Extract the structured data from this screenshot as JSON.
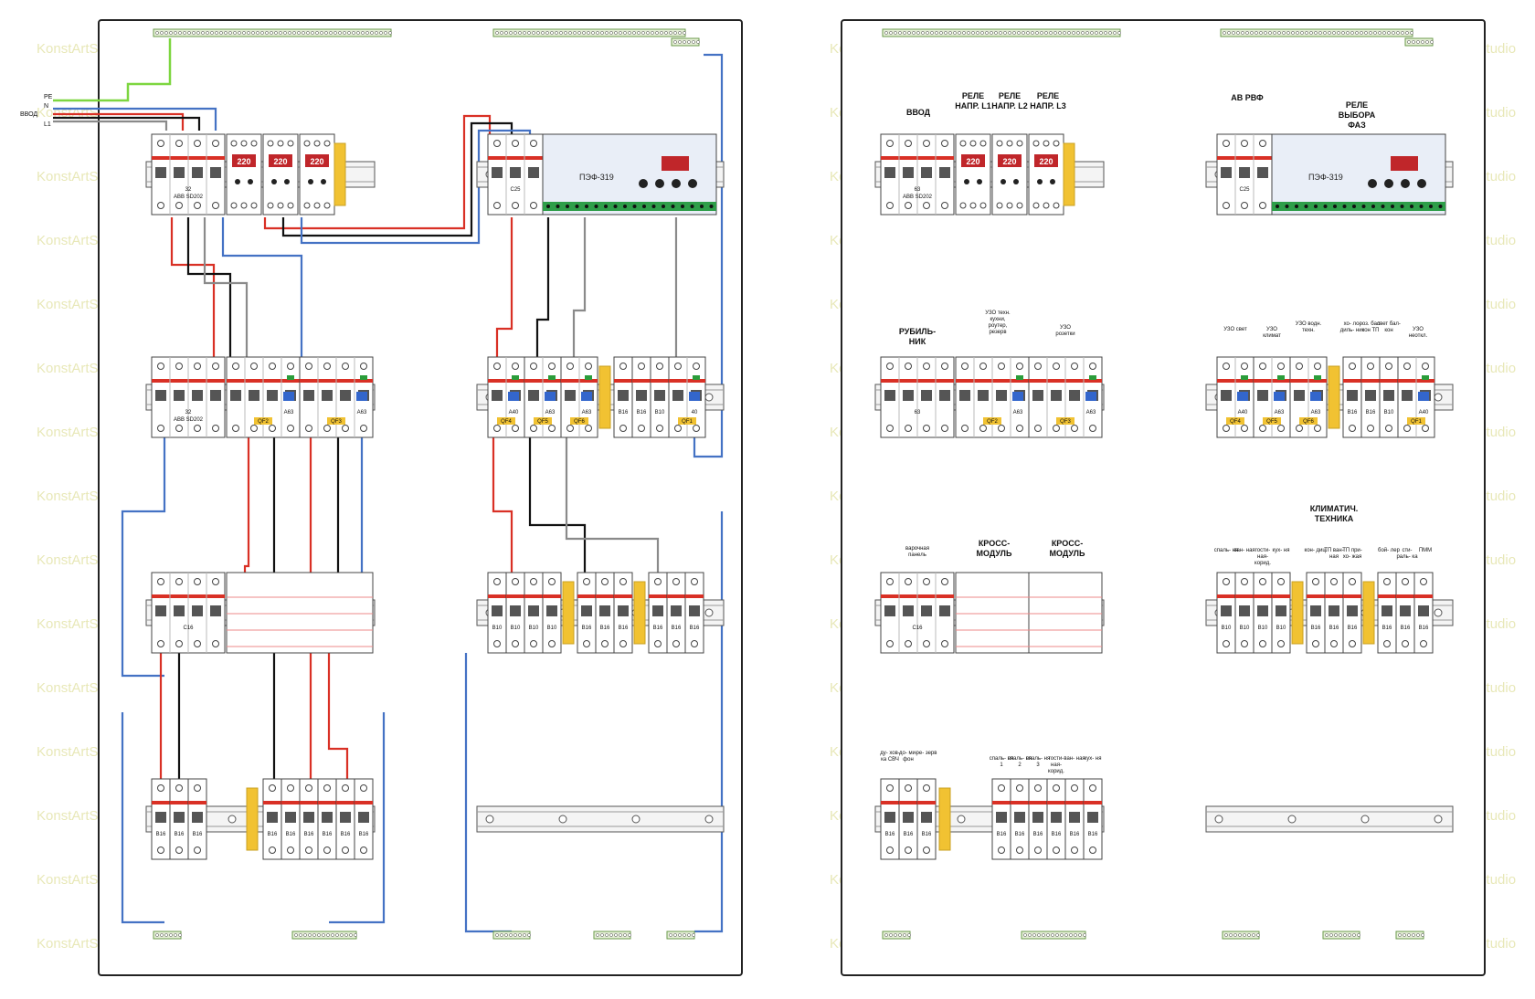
{
  "watermark": "KonstArtStudio",
  "inputs": {
    "pe": "PE",
    "n": "N",
    "l1": "L1",
    "l2": "L2",
    "l3": "L3",
    "vvod": "ВВОД"
  },
  "colors": {
    "pe": "#7dd640",
    "n": "#4472c4",
    "l1": "#d93025",
    "l2": "#111111",
    "l3": "#8a8a8a",
    "module_red": "#d93025",
    "busbar_yellow": "#f1c232"
  },
  "relay_display": "220",
  "pef_label": "ПЭФ-319",
  "left": {
    "row1": {
      "main_breaker": "32",
      "main_breaker_sub": "ABB SD202",
      "pef_breaker": "C25"
    },
    "row2": {
      "rubilnik": "32",
      "rubilnik_sub": "ABB SD202",
      "rcd2": {
        "rating": "A63",
        "tag": "QF2"
      },
      "rcd3": {
        "rating": "A63",
        "tag": "QF3"
      },
      "group_a": [
        {
          "rating": "A40",
          "tag": "QF4"
        },
        {
          "rating": "A63",
          "tag": "QF5"
        },
        {
          "rating": "A63",
          "tag": "QF6"
        }
      ],
      "group_b": [
        "B16",
        "B16",
        "B10"
      ],
      "rcd1": {
        "rating": "40",
        "tag": "QF1"
      }
    },
    "row3": {
      "c16": "C16",
      "b_groups": [
        "B10",
        "B10",
        "B10",
        "B10",
        "B16",
        "B16",
        "B16",
        "B16",
        "B16",
        "B16"
      ]
    },
    "row4": {
      "g1": [
        "B16",
        "B16",
        "B16"
      ],
      "g2": [
        "B16",
        "B16",
        "B16",
        "B16",
        "B16",
        "B16"
      ]
    }
  },
  "right": {
    "row1_labels": {
      "vvod": "ВВОД",
      "rele1": "РЕЛЕ НАПР. L1",
      "rele2": "РЕЛЕ НАПР. L2",
      "rele3": "РЕЛЕ НАПР. L3",
      "avrvf": "АВ РВФ",
      "rele_vybora": "РЕЛЕ ВЫБОРА ФАЗ"
    },
    "row1": {
      "main": "63",
      "main_sub": "ABB SD202",
      "pef_breaker": "C25"
    },
    "row2_labels": {
      "rubilnik": "РУБИЛЬ- НИК",
      "uzo_teh": "УЗО техн. кухни, роутер, резерв",
      "uzo_roz": "УЗО розетки",
      "uzo_svet": "УЗО свет",
      "uzo_klimat": "УЗО климат",
      "uzo_vodn": "УЗО водн. техн.",
      "uzo_neotkl": "УЗО неоткл.",
      "small": [
        "хо- ло- диль- ник",
        "роз. бал- кон ТП",
        "свет бал- кон"
      ]
    },
    "row2": {
      "rubilnik": "63",
      "rcd2": {
        "rating": "A63",
        "tag": "QF2"
      },
      "rcd3": {
        "rating": "A63",
        "tag": "QF3"
      },
      "group_a": [
        {
          "rating": "A40",
          "tag": "QF4"
        },
        {
          "rating": "A63",
          "tag": "QF5"
        },
        {
          "rating": "A63",
          "tag": "QF6"
        }
      ],
      "group_b": [
        "B16",
        "B16",
        "B10"
      ],
      "rcd1": {
        "rating": "A40",
        "tag": "QF1"
      }
    },
    "row3_labels": {
      "varochnaya": "варочная панель",
      "cross1": "КРОСС- МОДУЛЬ",
      "cross2": "КРОСС- МОДУЛЬ",
      "klimat": "КЛИМАТИЧ. ТЕХНИКА",
      "small": [
        "спаль- ня",
        "ван- ная",
        "гости- ная- корид.",
        "кух- ня",
        "кон- диц.",
        "ТП ван- ная",
        "ТП при- хо- жая",
        "бой- лер",
        "сти- раль- ка",
        "ПММ"
      ]
    },
    "row3": {
      "c16": "C16",
      "b_groups": [
        "B10",
        "B10",
        "B10",
        "B10",
        "B16",
        "B16",
        "B16",
        "B16",
        "B16",
        "B16"
      ]
    },
    "row4_labels": {
      "g1": [
        "ду- хов- ка СВЧ",
        "до- ми- фон",
        "ре- зерв"
      ],
      "g2": [
        "спаль- ня 1",
        "спаль- ня 2",
        "спаль- ня 3",
        "гости- ная- корид.",
        "ван- ная",
        "кух- ня"
      ]
    },
    "row4": {
      "g1": [
        "B16",
        "B16",
        "B16"
      ],
      "g2": [
        "B16",
        "B16",
        "B16",
        "B16",
        "B16",
        "B16"
      ]
    }
  }
}
